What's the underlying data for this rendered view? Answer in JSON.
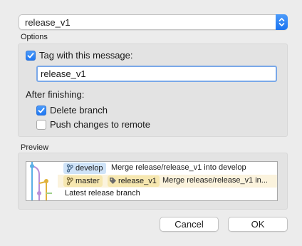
{
  "branch_select": {
    "value": "release_v1"
  },
  "options": {
    "label": "Options",
    "tag_checkbox": {
      "label": "Tag with this message:",
      "checked": true
    },
    "tag_message": "release_v1",
    "after_finishing_label": "After finishing:",
    "delete_branch": {
      "label": "Delete branch",
      "checked": true
    },
    "push_remote": {
      "label": "Push changes to remote",
      "checked": false
    }
  },
  "preview": {
    "label": "Preview",
    "rows": [
      {
        "badges": [
          {
            "type": "branch",
            "text": "develop",
            "color": "#cfe3f8"
          }
        ],
        "message": "Merge release/release_v1 into develop",
        "highlighted": false
      },
      {
        "badges": [
          {
            "type": "branch",
            "text": "master",
            "color": "#f6e7b0"
          },
          {
            "type": "tag",
            "text": "release_v1",
            "color": "#f6e7b0"
          }
        ],
        "message": "Merge release/release_v1 in...",
        "highlighted": true
      },
      {
        "badges": [],
        "message": "Latest release branch",
        "highlighted": false
      }
    ],
    "graph_colors": [
      "#5ab0e6",
      "#b98fd8",
      "#e0b23a",
      "#9ed08a"
    ]
  },
  "buttons": {
    "cancel": "Cancel",
    "ok": "OK"
  },
  "colors": {
    "accent": "#1f77f2",
    "background": "#ececec",
    "group_box": "#e3e3e3"
  }
}
